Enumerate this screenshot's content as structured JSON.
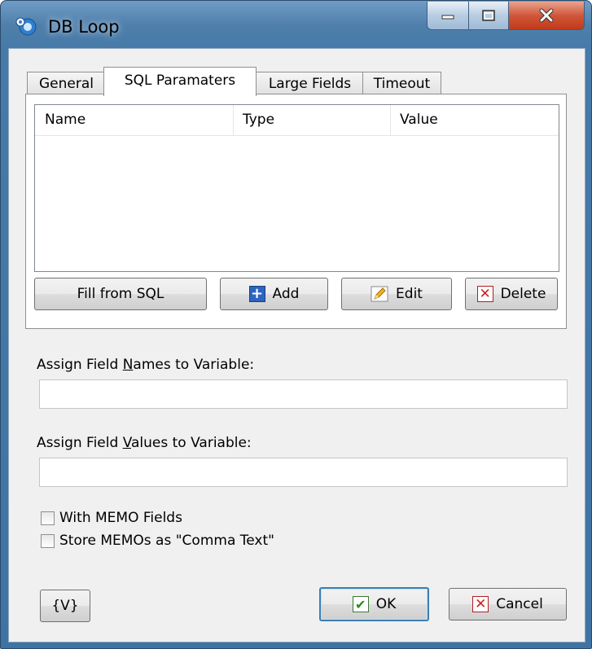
{
  "window": {
    "title": "DB Loop"
  },
  "tabs": [
    {
      "label": "General"
    },
    {
      "label": "SQL Paramaters",
      "active": true
    },
    {
      "label": "Large Fields"
    },
    {
      "label": "Timeout"
    }
  ],
  "list": {
    "columns": [
      "Name",
      "Type",
      "Value"
    ],
    "rows": []
  },
  "list_buttons": {
    "fill": "Fill from SQL",
    "add": "Add",
    "edit": "Edit",
    "delete": "Delete"
  },
  "names_field": {
    "label_pre": "Assign Field ",
    "label_u": "N",
    "label_post": "ames to Variable:",
    "value": ""
  },
  "values_field": {
    "label_pre": "Assign Field ",
    "label_u": "V",
    "label_post": "alues to Variable:",
    "value": ""
  },
  "checkboxes": {
    "memo": {
      "label": "With MEMO Fields",
      "checked": false
    },
    "comma": {
      "label": "Store MEMOs as \"Comma Text\"",
      "checked": false
    }
  },
  "footer": {
    "vars": "{V}",
    "ok": "OK",
    "cancel": "Cancel"
  },
  "icons": {
    "app": "db-loop-icon",
    "minimize": "minimize-icon",
    "maximize": "maximize-icon",
    "close": "close-icon"
  }
}
